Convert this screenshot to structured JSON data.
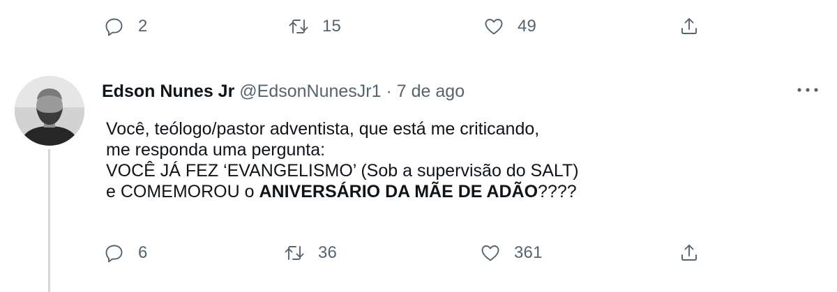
{
  "prev_tweet": {
    "actions": {
      "reply": {
        "icon": "reply-icon",
        "count": "2"
      },
      "retweet": {
        "icon": "retweet-icon",
        "count": "15"
      },
      "like": {
        "icon": "heart-icon",
        "count": "49"
      },
      "share": {
        "icon": "share-icon"
      }
    }
  },
  "tweet": {
    "author": {
      "name": "Edson Nunes Jr",
      "handle": "@EdsonNunesJr1",
      "separator": "·",
      "date": "7 de ago"
    },
    "text": {
      "line1": "Você, teólogo/pastor adventista, que está me criticando,",
      "line2": "me responda uma pergunta:",
      "line3": "VOCÊ JÁ FEZ ‘EVANGELISMO’ (Sob a supervisão do SALT)",
      "line4_start": "e COMEMOROU o ",
      "line4_bold": "ANIVERSÁRIO DA MÃE DE ADÃO",
      "line4_end": "????"
    },
    "actions": {
      "reply": {
        "icon": "reply-icon",
        "count": "6"
      },
      "retweet": {
        "icon": "retweet-icon",
        "count": "36"
      },
      "like": {
        "icon": "heart-icon",
        "count": "361"
      },
      "share": {
        "icon": "share-icon"
      }
    }
  },
  "colors": {
    "text_primary": "#0f1419",
    "text_secondary": "#536471",
    "thread_line": "#cfd9de",
    "background": "#ffffff"
  }
}
